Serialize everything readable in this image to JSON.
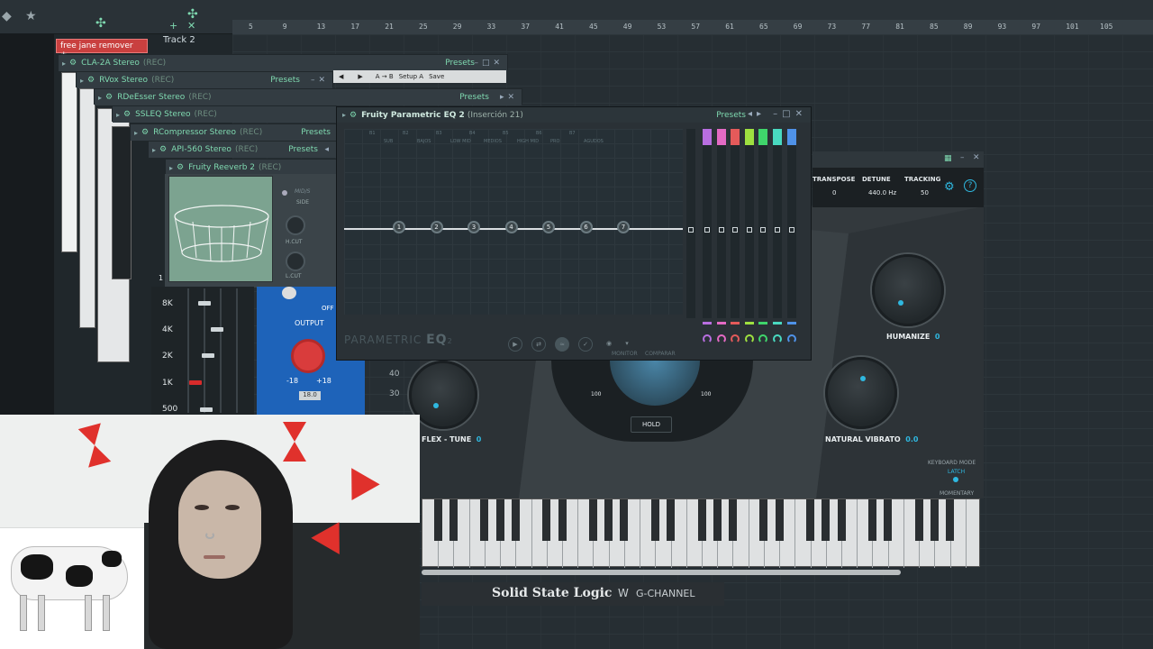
{
  "topbar": {
    "ruler": [
      "5",
      "9",
      "13",
      "17",
      "21",
      "25",
      "29",
      "33",
      "37",
      "41",
      "45",
      "49",
      "53",
      "57",
      "61",
      "65",
      "69",
      "73",
      "77",
      "81",
      "85",
      "89",
      "93",
      "97",
      "101",
      "105"
    ],
    "track_label": "Track 2"
  },
  "mixer": {
    "insert_name": "free jane remover +..."
  },
  "plugins": [
    {
      "name": "CLA-2A Stereo",
      "rec": "(REC)",
      "presets": "Presets"
    },
    {
      "name": "RVox Stereo",
      "rec": "(REC)",
      "presets": "Presets"
    },
    {
      "name": "RDeEsser Stereo",
      "rec": "(REC)",
      "presets": "Presets"
    },
    {
      "name": "SSLEQ Stereo",
      "rec": "(REC)",
      "presets": ""
    },
    {
      "name": "RCompressor Stereo",
      "rec": "(REC)",
      "presets": "Presets"
    },
    {
      "name": "API-560 Stereo",
      "rec": "(REC)",
      "presets": "Presets"
    },
    {
      "name": "Fruity Reeverb 2",
      "rec": "(REC)",
      "presets": ""
    }
  ],
  "transport": {
    "setup": "Setup A",
    "save": "Save",
    "ab": "A → B"
  },
  "reverb": {
    "mid_label": "MID/S",
    "side_label": "SIDE",
    "hcut": "H.CUT",
    "lcut": "L.CUT",
    "one": "1"
  },
  "eq_bank": {
    "bands": [
      "8K",
      "4K",
      "2K",
      "1K",
      "500"
    ]
  },
  "compressor": {
    "output": "OUTPUT",
    "min": "-18",
    "max": "+18",
    "value": "18.0",
    "off": "OFF"
  },
  "eq": {
    "title": "Fruity Parametric EQ 2",
    "subtitle": "(Inserción 21)",
    "presets": "Presets",
    "band_names": [
      "SUB",
      "BAJOS",
      "LOW MID",
      "MEDIOS",
      "HIGH MID",
      "PRO",
      "AGUDOS"
    ],
    "band_ids": [
      "B1",
      "B2",
      "B3",
      "B4",
      "B5",
      "B6",
      "B7"
    ],
    "nodes": [
      "1",
      "2",
      "3",
      "4",
      "5",
      "6",
      "7"
    ],
    "brand_a": "PARAMETRIC",
    "brand_b": "EQ",
    "brand_c": "2",
    "monitor": "MONITOR",
    "compare": "COMPARAR",
    "fader_colors": [
      "#b86ee0",
      "#e46ac4",
      "#e45a5a",
      "#9ee040",
      "#3fd56b",
      "#49d9c0",
      "#4f92e8"
    ]
  },
  "synth": {
    "transpose_label": "TRANSPOSE",
    "transpose_val": "0",
    "detune_label": "DETUNE",
    "detune_val": "440.0 Hz",
    "tracking_label": "TRACKING",
    "tracking_val": "50",
    "humanize_label": "HUMANIZE",
    "humanize_val": "0",
    "flex_label": "FLEX - TUNE",
    "flex_val": "0",
    "vibrato_label": "NATURAL VIBRATO",
    "vibrato_val": "0.0",
    "hold": "HOLD",
    "scale_left": "100",
    "scale_right": "100",
    "side_40": "40",
    "side_30": "30",
    "kb_mode": "KEYBOARD MODE",
    "latch": "LATCH",
    "momentary": "MOMENTARY"
  },
  "footer": {
    "brand": "Solid State Logic",
    "channel": "G-CHANNEL"
  }
}
